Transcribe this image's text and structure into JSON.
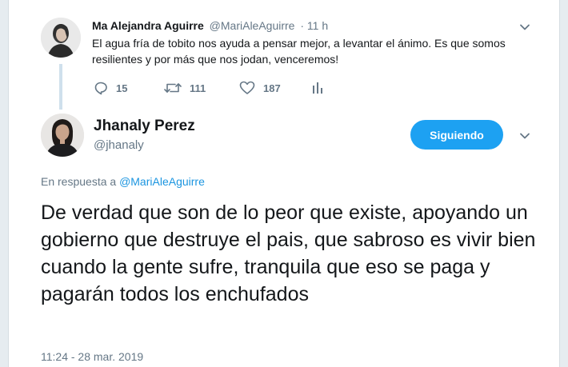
{
  "parent_tweet": {
    "name": "Ma Alejandra Aguirre",
    "handle": "@MariAleAguirre",
    "time": "· 11 h",
    "text": "El agua fría de tobito nos ayuda a pensar mejor, a levantar el ánimo. Es que somos resilientes y por más que nos jodan, venceremos!",
    "actions": {
      "replies": "15",
      "retweets": "111",
      "likes": "187"
    }
  },
  "main_tweet": {
    "name": "Jhanaly Perez",
    "handle": "@jhanaly",
    "follow_label": "Siguiendo",
    "reply_prefix": "En respuesta a",
    "reply_to": "@MariAleAguirre",
    "text": "De verdad que son de lo peor que existe, apoyando un gobierno que destruye el pais, que sabroso es vivir bien cuando la gente sufre, tranquila que eso se paga y pagarán todos los enchufados",
    "timestamp": "11:24 - 28 mar. 2019"
  },
  "colors": {
    "accent": "#1da1f2",
    "link": "#1b95e0",
    "text": "#14171a",
    "secondary": "#657786",
    "thread_line": "#cfe0ec"
  },
  "icons": {
    "reply": "reply-icon",
    "retweet": "retweet-icon",
    "like": "heart-icon",
    "analytics": "analytics-icon",
    "menu": "chevron-down-icon"
  }
}
